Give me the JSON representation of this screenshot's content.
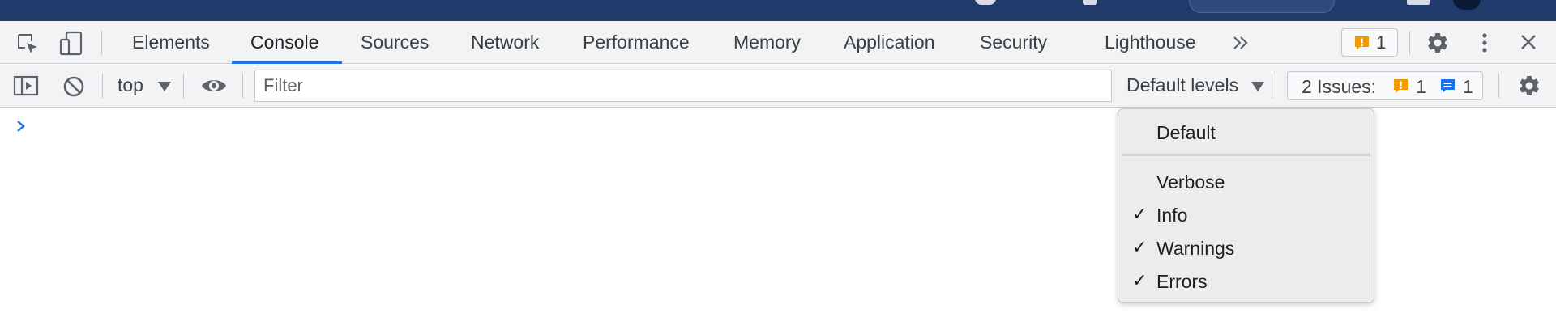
{
  "colors": {
    "accent": "#1a73e8",
    "warning": "#f29900",
    "info": "#1a73e8",
    "top_strip": "#1f3a6b"
  },
  "tabs": {
    "items": [
      {
        "label": "Elements",
        "active": false
      },
      {
        "label": "Console",
        "active": true
      },
      {
        "label": "Sources",
        "active": false
      },
      {
        "label": "Network",
        "active": false
      },
      {
        "label": "Performance",
        "active": false
      },
      {
        "label": "Memory",
        "active": false
      },
      {
        "label": "Application",
        "active": false
      },
      {
        "label": "Security",
        "active": false
      },
      {
        "label": "Lighthouse",
        "active": false
      }
    ],
    "more_icon": "double-chevron-right-icon",
    "issues_badge_count": "1"
  },
  "toolbar": {
    "context": "top",
    "filter_placeholder": "Filter",
    "levels_label": "Default levels",
    "issues_label": "2 Issues:",
    "warning_count": "1",
    "info_count": "1"
  },
  "levels_menu": {
    "default_label": "Default",
    "items": [
      {
        "label": "Verbose",
        "checked": false
      },
      {
        "label": "Info",
        "checked": true
      },
      {
        "label": "Warnings",
        "checked": true
      },
      {
        "label": "Errors",
        "checked": true
      }
    ]
  }
}
